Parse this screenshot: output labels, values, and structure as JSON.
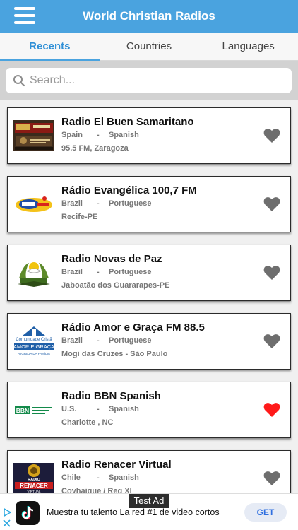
{
  "header": {
    "title": "World Christian Radios"
  },
  "tabs": [
    {
      "label": "Recents",
      "active": true
    },
    {
      "label": "Countries",
      "active": false
    },
    {
      "label": "Languages",
      "active": false
    }
  ],
  "search": {
    "placeholder": "Search..."
  },
  "stations": [
    {
      "name": "Radio El Buen Samaritano",
      "country": "Spain",
      "separator": "-",
      "language": "Spanish",
      "location": "95.5 FM, Zaragoza",
      "favorite": false,
      "logo": "el-buen-samaritano-logo"
    },
    {
      "name": "Rádio Evangélica 100,7 FM",
      "country": "Brazil",
      "separator": "-",
      "language": "Portuguese",
      "location": "Recife-PE",
      "favorite": false,
      "logo": "radio-evangelica-logo"
    },
    {
      "name": "Radio Novas de Paz",
      "country": "Brazil",
      "separator": "-",
      "language": "Portuguese",
      "location": "Jaboatão dos Guararapes-PE",
      "favorite": false,
      "logo": "novas-de-paz-logo"
    },
    {
      "name": "Rádio Amor e Graça FM 88.5",
      "country": "Brazil",
      "separator": "-",
      "language": "Portuguese",
      "location": "Mogi das Cruzes - São Paulo",
      "favorite": false,
      "logo": "amor-e-graca-logo",
      "logo_text": [
        "Comunidade Cristã",
        "AMOR E GRAÇA",
        "A IGREJA DA FAMÍLIA"
      ]
    },
    {
      "name": "Radio BBN Spanish",
      "country": "U.S.",
      "separator": "-",
      "language": "Spanish",
      "location": "Charlotte , NC",
      "favorite": true,
      "logo": "bbn-logo",
      "logo_text": [
        "BBN"
      ]
    },
    {
      "name": "Radio Renacer Virtual",
      "country": "Chile",
      "separator": "-",
      "language": "Spanish",
      "location": "Coyhaique / Reg XI",
      "favorite": false,
      "logo": "renacer-virtual-logo",
      "logo_text": [
        "RADIO",
        "RENACER",
        "VIRTUAL"
      ]
    }
  ],
  "ad": {
    "label": "Test Ad",
    "text": "Muestra tu talento La red #1 de video cortos",
    "cta": "GET"
  },
  "colors": {
    "header": "#4aa3df",
    "heart_inactive": "#6e6e6e",
    "heart_active": "#ff1a1a"
  }
}
